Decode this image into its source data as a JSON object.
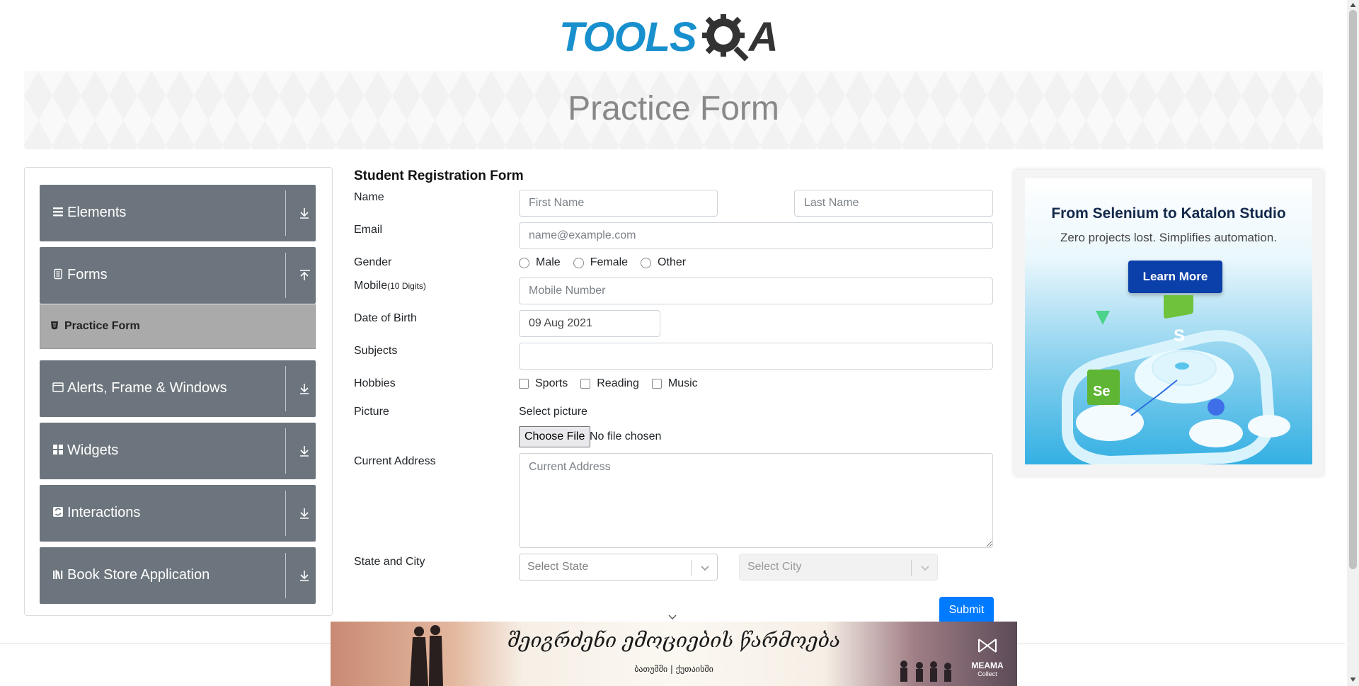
{
  "header": {
    "logo_primary": "TOOLS",
    "logo_secondary": "A",
    "logo_icon": "gear-q-icon",
    "page_title": "Practice Form"
  },
  "sidebar": {
    "groups": [
      {
        "label": "Elements",
        "icon": "hamburger-icon",
        "toggle": "expand-icon"
      },
      {
        "label": "Forms",
        "icon": "document-icon",
        "toggle": "collapse-icon"
      },
      {
        "label": "Alerts, Frame & Windows",
        "icon": "window-icon",
        "toggle": "expand-icon"
      },
      {
        "label": "Widgets",
        "icon": "widgets-icon",
        "toggle": "expand-icon"
      },
      {
        "label": "Interactions",
        "icon": "interactions-icon",
        "toggle": "expand-icon"
      },
      {
        "label": "Book Store Application",
        "icon": "books-icon",
        "toggle": "expand-icon"
      }
    ],
    "active_item": {
      "label": "Practice Form",
      "icon": "html-icon"
    }
  },
  "form": {
    "title": "Student Registration Form",
    "name": {
      "label": "Name",
      "first_placeholder": "First Name",
      "last_placeholder": "Last Name",
      "first_value": "",
      "last_value": ""
    },
    "email": {
      "label": "Email",
      "placeholder": "name@example.com",
      "value": ""
    },
    "gender": {
      "label": "Gender",
      "options": [
        "Male",
        "Female",
        "Other"
      ]
    },
    "mobile": {
      "label": "Mobile",
      "hint": "(10 Digits)",
      "placeholder": "Mobile Number",
      "value": ""
    },
    "dob": {
      "label": "Date of Birth",
      "value": "09 Aug 2021"
    },
    "subjects": {
      "label": "Subjects",
      "value": ""
    },
    "hobbies": {
      "label": "Hobbies",
      "options": [
        "Sports",
        "Reading",
        "Music"
      ]
    },
    "picture": {
      "label": "Picture",
      "caption": "Select picture",
      "button": "Choose File",
      "status": "No file chosen"
    },
    "address": {
      "label": "Current Address",
      "placeholder": "Current Address",
      "value": ""
    },
    "state_city": {
      "label": "State and City",
      "state_placeholder": "Select State",
      "city_placeholder": "Select City"
    },
    "submit": "Submit"
  },
  "ad_right": {
    "title": "From Selenium to Katalon Studio",
    "subtitle": "Zero projects lost. Simplifies automation.",
    "button": "Learn More"
  },
  "ad_bottom": {
    "title": "შეიგრძენი ემოციების წარმოება",
    "subtitle": "ბათუმში | ქუთაისში",
    "brand": "MEAMA",
    "brand_sub": "Collect"
  },
  "colors": {
    "sidebar_group": "#6c757d",
    "sidebar_active": "#aaaaaa",
    "primary_button": "#007bff",
    "logo_blue": "#1990ce",
    "ad_button": "#0b3fa9"
  }
}
